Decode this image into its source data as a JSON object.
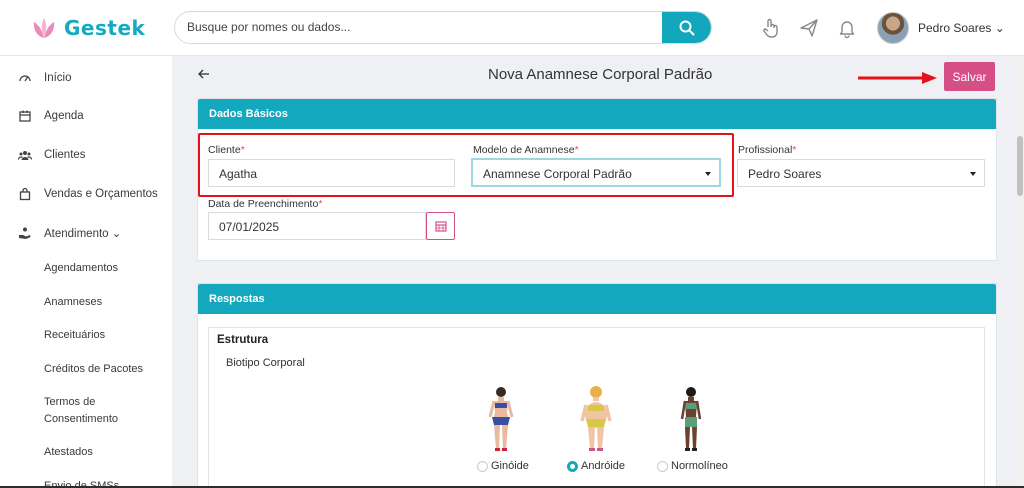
{
  "app": {
    "logo_text": "Gestek",
    "brand_color": "#14a8be",
    "accent_color": "#d54f86"
  },
  "search": {
    "placeholder": "Busque por nomes ou dados..."
  },
  "user": {
    "name": "Pedro Soares ⌄"
  },
  "sidebar": {
    "items": [
      {
        "label": "Início",
        "icon": "speedometer-icon"
      },
      {
        "label": "Agenda",
        "icon": "calendar-icon"
      },
      {
        "label": "Clientes",
        "icon": "users-icon"
      },
      {
        "label": "Vendas e Orçamentos",
        "icon": "shopping-bag-icon"
      },
      {
        "label": "Atendimento ⌄",
        "icon": "hand-care-icon"
      }
    ],
    "sub_items": [
      "Agendamentos",
      "Anamneses",
      "Receituários",
      "Créditos de Pacotes",
      "Termos de Consentimento",
      "Atestados",
      "Envio de SMSs"
    ]
  },
  "page": {
    "title": "Nova Anamnese Corporal Padrão",
    "save_label": "Salvar"
  },
  "dados_basicos": {
    "header": "Dados Básicos",
    "cliente": {
      "label": "Cliente",
      "value": "Agatha"
    },
    "modelo": {
      "label": "Modelo de Anamnese",
      "value": "Anamnese Corporal Padrão"
    },
    "profissional": {
      "label": "Profissional",
      "value": "Pedro Soares"
    },
    "data": {
      "label": "Data de Preenchimento",
      "value": "07/01/2025"
    },
    "required_mark": "*"
  },
  "respostas": {
    "header": "Respostas",
    "section_title": "Estrutura",
    "question": "Biotipo Corporal",
    "options": [
      {
        "label": "Ginóide",
        "checked": false
      },
      {
        "label": "Andróide",
        "checked": true
      },
      {
        "label": "Normolíneo",
        "checked": false
      }
    ]
  }
}
